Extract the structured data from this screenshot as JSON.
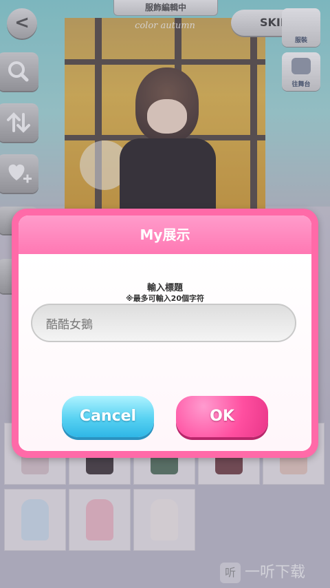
{
  "header": {
    "editing_label": "服飾編輯中"
  },
  "controls": {
    "back_glyph": "<",
    "skip_label": "SKIP",
    "skip_arrow": ">",
    "tile_costume_label": "服裝",
    "tile_stage_label": "往舞台"
  },
  "preview": {
    "watermark": "color autumn"
  },
  "dialog": {
    "title": "My展示",
    "prompt_title": "輸入標題",
    "prompt_hint": "※最多可輸入20個字符",
    "input_value": "酷酷女鵝",
    "cancel_label": "Cancel",
    "ok_label": "OK"
  },
  "items": {
    "colors": [
      "#d8c3c9",
      "#3a2f33",
      "#4d6b57",
      "#6e3a3f",
      "#e6c6bd",
      "#cfe0ef",
      "#f1b9c6",
      "#f4ecea"
    ]
  },
  "watermark": {
    "badge": "听",
    "text": "一听下载"
  },
  "theme": {
    "accent": "#ff6aa8",
    "cancel_color": "#4ccbf0",
    "ok_color": "#ff4fa0"
  },
  "icons": [
    "back-icon",
    "search-icon",
    "sort-icon",
    "heart-plus-icon",
    "skip-arrow-icon"
  ]
}
